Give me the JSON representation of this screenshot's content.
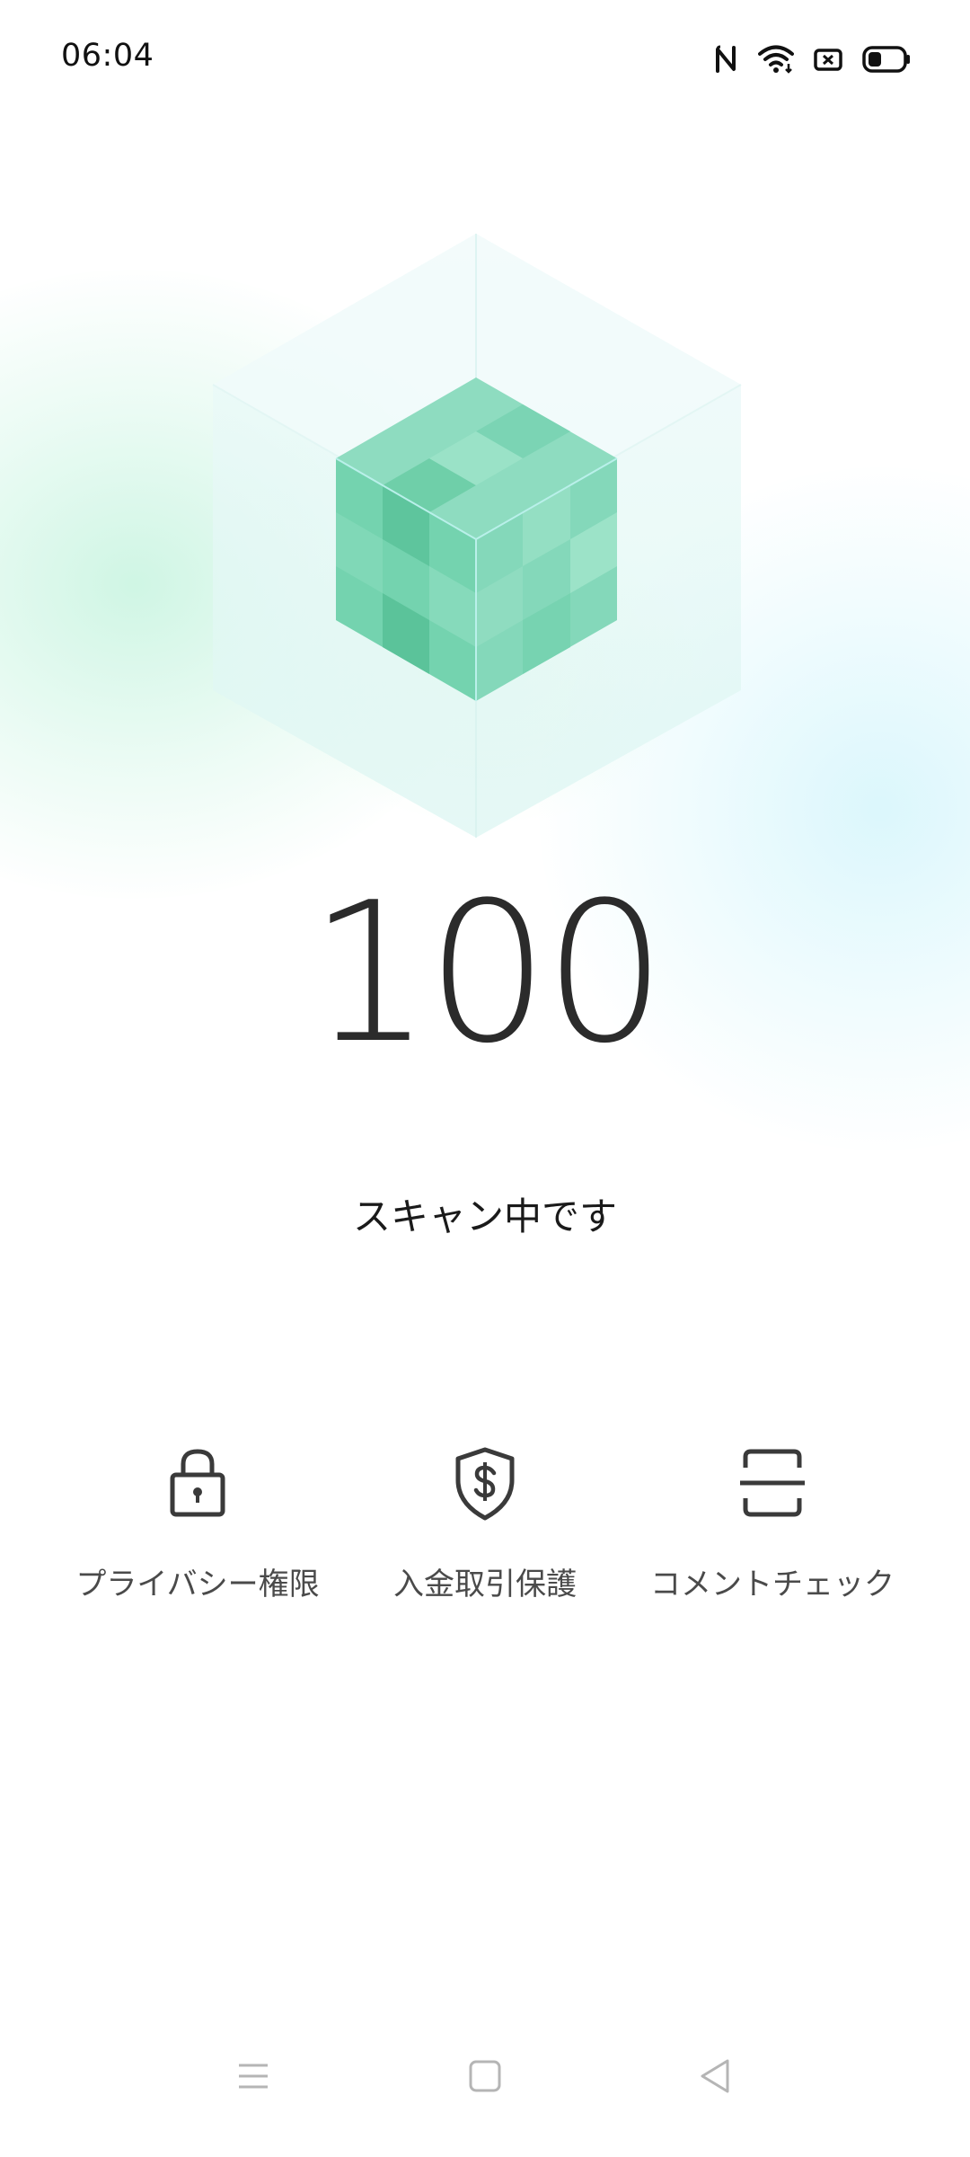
{
  "status_bar": {
    "time": "06:04",
    "icons": [
      "nfc-icon",
      "wifi-icon",
      "notification-icon",
      "battery-icon"
    ]
  },
  "hero": {
    "graphic": "green-cube-icon",
    "colors": {
      "cube_face_top": "#8edcc0",
      "cube_face_left": "#6fd0ac",
      "cube_face_right": "#85d8bb",
      "hex_tint": "#e4f8f6"
    }
  },
  "scan": {
    "score": "100",
    "status": "スキャン中です"
  },
  "features": [
    {
      "label": "プライバシー権限",
      "icon": "lock-icon"
    },
    {
      "label": "入金取引保護",
      "icon": "shield-dollar-icon"
    },
    {
      "label": "コメントチェック",
      "icon": "scan-frame-icon"
    }
  ],
  "nav_bar": {
    "buttons": [
      "menu-icon",
      "home-icon",
      "back-icon"
    ]
  }
}
